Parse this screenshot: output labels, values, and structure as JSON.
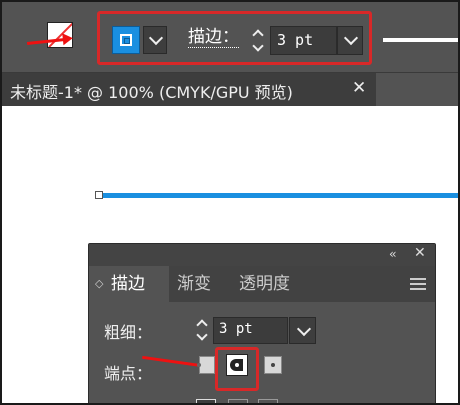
{
  "control_bar": {
    "stroke_label": "描边：",
    "stroke_weight_value": "3 pt",
    "fill_swatch_icon": "fill-none-swatch-icon",
    "stroke_swatch_color": "#1a8fe0"
  },
  "document_tab": {
    "title": "未标题-1* @ 100% (CMYK/GPU 预览)",
    "close_symbol": "✕"
  },
  "stroke_panel": {
    "collapse_symbol": "‹‹",
    "close_symbol": "✕",
    "tabs": [
      {
        "label": "描边",
        "active": true
      },
      {
        "label": "渐变",
        "active": false
      },
      {
        "label": "透明度",
        "active": false
      }
    ],
    "weight_label": "粗细：",
    "weight_value": "3 pt",
    "cap_label": "端点："
  },
  "colors": {
    "highlight_red": "#d82828",
    "stroke_blue": "#1a8fe0",
    "ui_gray": "#535353"
  }
}
